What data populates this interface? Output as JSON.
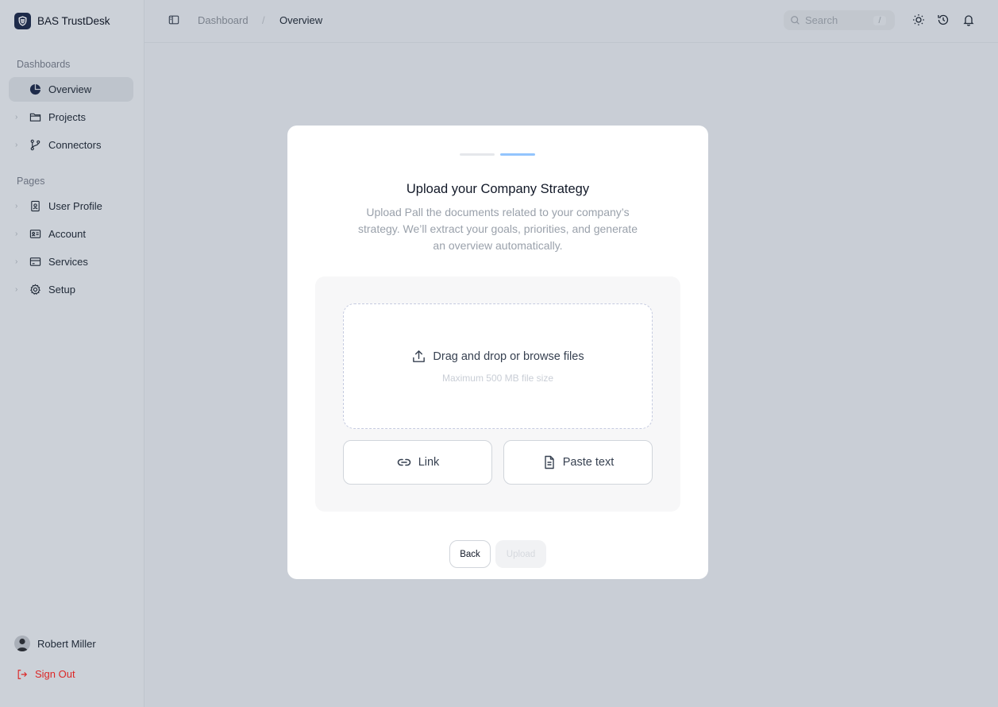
{
  "app": {
    "name": "BAS TrustDesk"
  },
  "sidebar": {
    "sections": [
      {
        "label": "Dashboards"
      },
      {
        "label": "Pages"
      }
    ],
    "items": [
      {
        "label": "Overview",
        "icon": "pie-chart-icon",
        "active": true
      },
      {
        "label": "Projects",
        "icon": "folder-icon"
      },
      {
        "label": "Connectors",
        "icon": "git-branch-icon"
      },
      {
        "label": "User Profile",
        "icon": "id-badge-icon"
      },
      {
        "label": "Account",
        "icon": "id-card-icon"
      },
      {
        "label": "Services",
        "icon": "credit-card-icon"
      },
      {
        "label": "Setup",
        "icon": "gear-icon"
      }
    ],
    "user": {
      "name": "Robert Miller"
    },
    "sign_out": "Sign Out"
  },
  "header": {
    "breadcrumb": [
      "Dashboard",
      "Overview"
    ],
    "breadcrumb_separator": "/",
    "search": {
      "placeholder": "Search",
      "shortcut": "/"
    },
    "icons": [
      "sun-icon",
      "history-icon",
      "bell-icon"
    ]
  },
  "modal": {
    "steps": {
      "total": 2,
      "current": 2
    },
    "title": "Upload your Company Strategy",
    "description": "Upload Pall the documents related to your company’s strategy. We’ll extract your goals, priorities, and generate an overview automatically.",
    "dropzone": {
      "label": "Drag and drop or browse files",
      "hint": "Maximum 500 MB file size"
    },
    "options": {
      "link": "Link",
      "paste": "Paste text"
    },
    "back_label": "Back",
    "upload_label": "Upload"
  },
  "colors": {
    "accent": "#93c5fd",
    "brand": "#1e2b4a",
    "danger": "#dc2626"
  }
}
